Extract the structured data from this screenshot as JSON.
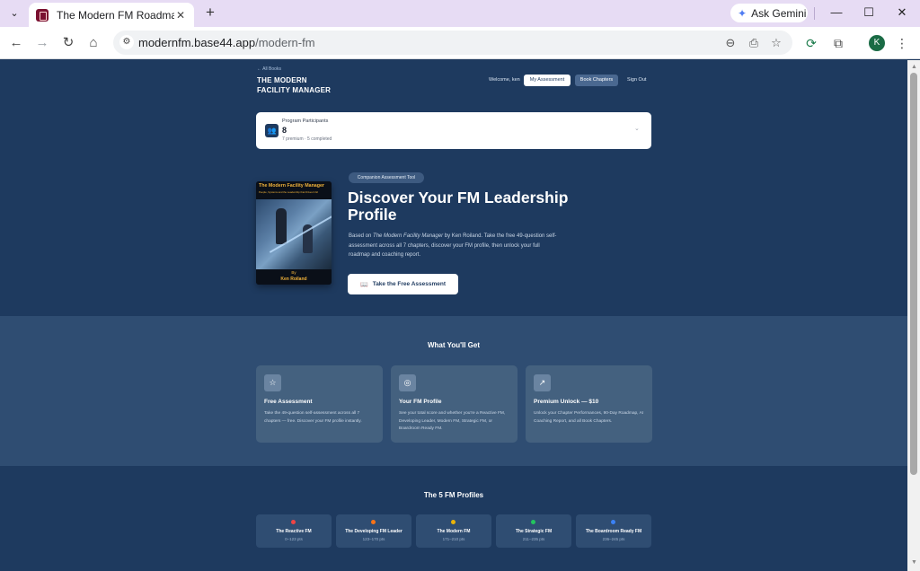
{
  "browser": {
    "tab_title": "The Modern FM Roadmap",
    "gemini_label": "Ask Gemini",
    "url_domain": "modernfm.base44.app",
    "url_path": "/modern-fm",
    "profile_initial": "K"
  },
  "header": {
    "back_link": "← All Books",
    "brand_line1": "THE MODERN",
    "brand_line2": "FACILITY MANAGER",
    "welcome": "Welcome, ken",
    "my_assessment": "My Assessment",
    "book_chapters": "Book Chapters",
    "sign_out": "Sign Out"
  },
  "participants": {
    "label": "Program Participants",
    "count": "8",
    "sub": "7 premium · 5 completed"
  },
  "book": {
    "title": "The Modern Facility Manager",
    "subtitle": "People, Systems and the Leadership that Drives It All",
    "by": "By",
    "author": "Ken Roiland"
  },
  "hero": {
    "badge": "Companion Assessment Tool",
    "title": "Discover Your FM Leadership Profile",
    "desc_pre": "Based on ",
    "desc_em": "The Modern Facility Manager",
    "desc_post": " by Ken Roiland. Take the free 49-question self-assessment across all 7 chapters, discover your FM profile, then unlock your full roadmap and coaching report.",
    "cta": "Take the Free Assessment"
  },
  "get": {
    "title": "What You'll Get",
    "cards": [
      {
        "title": "Free Assessment",
        "desc": "Take the 49-question self-assessment across all 7 chapters — free. Discover your FM profile instantly."
      },
      {
        "title": "Your FM Profile",
        "desc": "See your total score and whether you're a Reactive FM, Developing Leader, Modern FM, Strategic FM, or Boardroom Ready FM."
      },
      {
        "title": "Premium Unlock — $10",
        "desc": "Unlock your Chapter Performances, 90-Day Roadmap, AI Coaching Report, and all Book Chapters."
      }
    ]
  },
  "profiles": {
    "title": "The 5 FM Profiles",
    "items": [
      {
        "name": "The Reactive FM",
        "range": "0–123 pts",
        "color": "#ef4444"
      },
      {
        "name": "The Developing FM Leader",
        "range": "123–170 pts",
        "color": "#f97316"
      },
      {
        "name": "The Modern FM",
        "range": "171–210 pts",
        "color": "#eab308"
      },
      {
        "name": "The Strategic FM",
        "range": "211–235 pts",
        "color": "#22c55e"
      },
      {
        "name": "The Boardroom Ready FM",
        "range": "236–245 pts",
        "color": "#3b82f6"
      }
    ]
  }
}
